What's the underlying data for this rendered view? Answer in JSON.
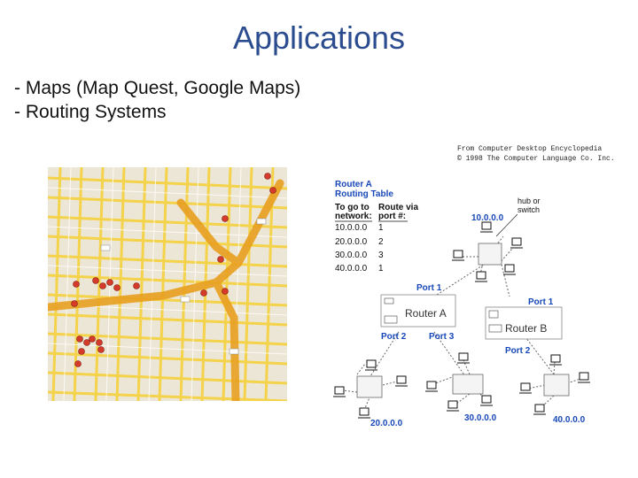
{
  "slide": {
    "title": "Applications",
    "bullets": [
      "- Maps (Map Quest, Google Maps)",
      "- Routing Systems"
    ]
  },
  "credit": {
    "line1": "From Computer Desktop Encyclopedia",
    "line2": "© 1998 The Computer Language Co. Inc."
  },
  "map": {
    "icon": "street-map-image-icon"
  },
  "diagram": {
    "router_a_title": "Router A",
    "routing_table_title": "Routing Table",
    "col1_line1": "To go to",
    "col1_line2": "network:",
    "col2_line1": "Route via",
    "col2_line2": "port #:",
    "rows": [
      {
        "network": "10.0.0.0",
        "port": "1"
      },
      {
        "network": "20.0.0.0",
        "port": "2"
      },
      {
        "network": "30.0.0.0",
        "port": "3"
      },
      {
        "network": "40.0.0.0",
        "port": "1"
      }
    ],
    "hub_line1": "hub or",
    "hub_line2": "switch",
    "router_a_label": "Router A",
    "router_b_label": "Router B",
    "ports": {
      "a1": "Port 1",
      "a2": "Port 2",
      "a3": "Port 3",
      "b1": "Port 1",
      "b2": "Port 2"
    },
    "networks": {
      "n10": "10.0.0.0",
      "n20": "20.0.0.0",
      "n30": "30.0.0.0",
      "n40": "40.0.0.0"
    },
    "colors": {
      "label_blue": "#1848b8",
      "map_road": "#f4c842",
      "highway": "#e8a020"
    }
  }
}
